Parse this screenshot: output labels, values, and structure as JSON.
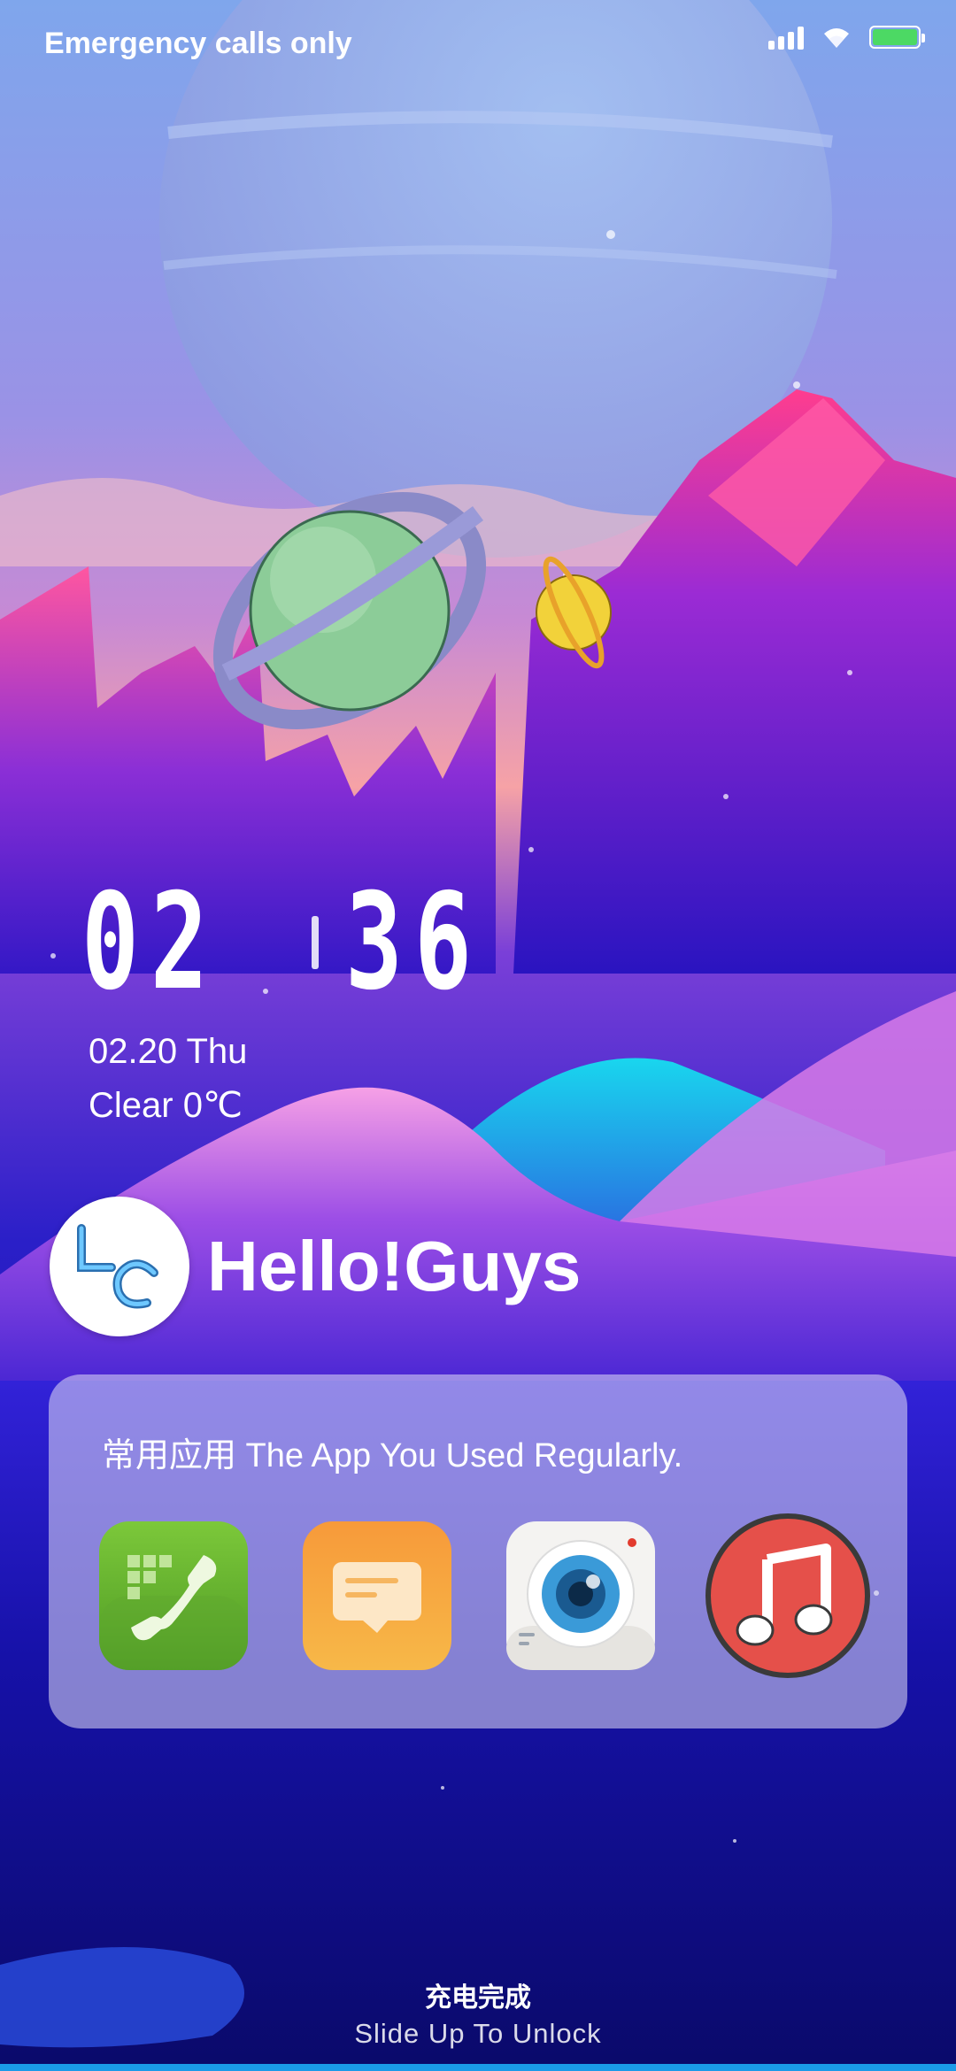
{
  "status_bar": {
    "carrier_text": "Emergency calls only",
    "battery_color": "#4cd964"
  },
  "clock": {
    "hours": "02",
    "minutes": "36",
    "date": "02.20 Thu",
    "weather": "Clear 0℃"
  },
  "profile": {
    "avatar_initials": "LC",
    "greeting": "Hello!Guys"
  },
  "apps_card": {
    "title": "常用应用 The App You Used  Regularly.",
    "apps": [
      {
        "name": "Phone",
        "icon": "phone-icon",
        "color": "#6ab62e"
      },
      {
        "name": "Messages",
        "icon": "message-icon",
        "color": "#f7a23c"
      },
      {
        "name": "Camera",
        "icon": "camera-icon",
        "color": "#f2f2f2"
      },
      {
        "name": "Music",
        "icon": "music-icon",
        "color": "#e5504a"
      }
    ]
  },
  "footer": {
    "charge_status": "充电完成",
    "unlock_hint": "Slide Up To Unlock"
  },
  "colors": {
    "sky_top": "#7fa6ec",
    "sky_mid": "#9b6fd8",
    "mountain_pink": "#ff3d9a",
    "deep_blue": "#2411c4"
  }
}
